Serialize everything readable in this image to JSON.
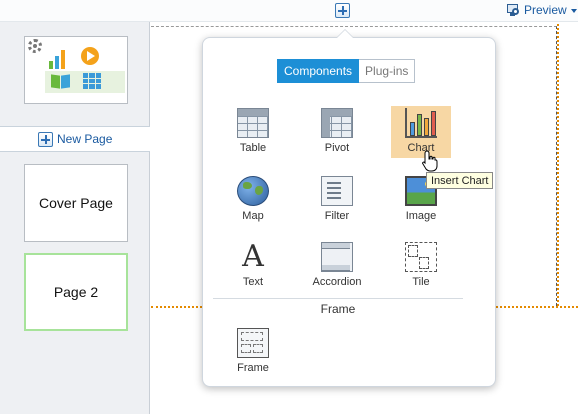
{
  "topbar": {
    "preview_label": "Preview"
  },
  "sidebar": {
    "new_page_label": "New Page",
    "pages": [
      {
        "label": "Cover Page"
      },
      {
        "label": "Page 2"
      }
    ]
  },
  "popup": {
    "tabs": [
      {
        "label": "Components",
        "active": true
      },
      {
        "label": "Plug-ins",
        "active": false
      }
    ],
    "components": [
      {
        "label": "Table",
        "icon": "table-icon"
      },
      {
        "label": "Pivot",
        "icon": "pivot-icon"
      },
      {
        "label": "Chart",
        "icon": "chart-icon",
        "highlighted": true
      },
      {
        "label": "Map",
        "icon": "map-icon"
      },
      {
        "label": "Filter",
        "icon": "filter-icon"
      },
      {
        "label": "Image",
        "icon": "image-icon"
      },
      {
        "label": "Text",
        "icon": "text-icon"
      },
      {
        "label": "Accordion",
        "icon": "accordion-icon"
      },
      {
        "label": "Tile",
        "icon": "tile-icon"
      }
    ],
    "frame_section_label": "Frame",
    "frame_item": {
      "label": "Frame",
      "icon": "frame-icon"
    },
    "text_icon_glyph": "A"
  },
  "tooltip": {
    "text": "Insert Chart"
  },
  "colors": {
    "accent": "#1d8fd6",
    "highlight": "#f7d7a4",
    "selected_page_border": "#a7e39a",
    "canvas_guide": "#e48a00"
  }
}
